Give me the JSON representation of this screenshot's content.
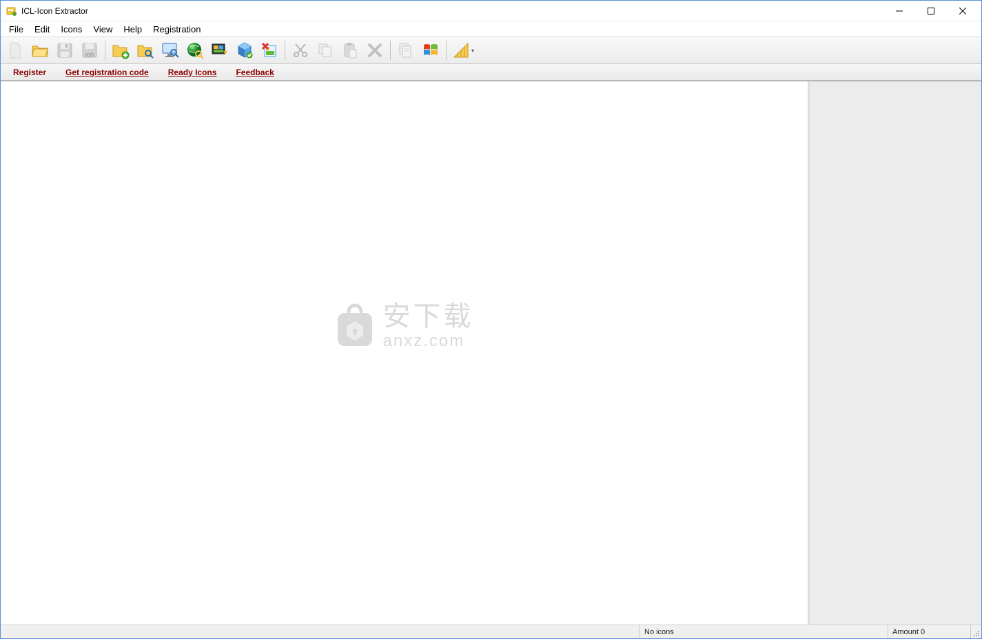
{
  "app": {
    "title": "ICL-Icon Extractor"
  },
  "menubar": {
    "items": [
      "File",
      "Edit",
      "Icons",
      "View",
      "Help",
      "Registration"
    ]
  },
  "toolbar": {
    "buttons": [
      {
        "name": "new-file",
        "enabled": false
      },
      {
        "name": "open-folder",
        "enabled": true
      },
      {
        "name": "save-disk",
        "enabled": false
      },
      {
        "name": "save-ico",
        "enabled": false
      },
      {
        "name": "sep"
      },
      {
        "name": "folder-add",
        "enabled": true
      },
      {
        "name": "folder-search",
        "enabled": true
      },
      {
        "name": "monitor-search",
        "enabled": true
      },
      {
        "name": "globe-search",
        "enabled": true
      },
      {
        "name": "image-extract",
        "enabled": true
      },
      {
        "name": "cube-3d",
        "enabled": true
      },
      {
        "name": "image-delete",
        "enabled": true
      },
      {
        "name": "sep"
      },
      {
        "name": "cut",
        "enabled": false
      },
      {
        "name": "copy",
        "enabled": false
      },
      {
        "name": "paste",
        "enabled": false
      },
      {
        "name": "delete-x",
        "enabled": false
      },
      {
        "name": "sep"
      },
      {
        "name": "document-multi",
        "enabled": false
      },
      {
        "name": "windows-logo",
        "enabled": true
      },
      {
        "name": "sep"
      },
      {
        "name": "ruler-triangle",
        "enabled": true,
        "dropdown": true
      }
    ]
  },
  "linkbar": {
    "register": "Register",
    "get_code": "Get registration code",
    "ready_icons": "Ready Icons",
    "feedback": "Feedback"
  },
  "watermark": {
    "cn": "安下载",
    "en": "anxz.com"
  },
  "statusbar": {
    "no_icons": "No icons",
    "amount": "Amount 0"
  }
}
